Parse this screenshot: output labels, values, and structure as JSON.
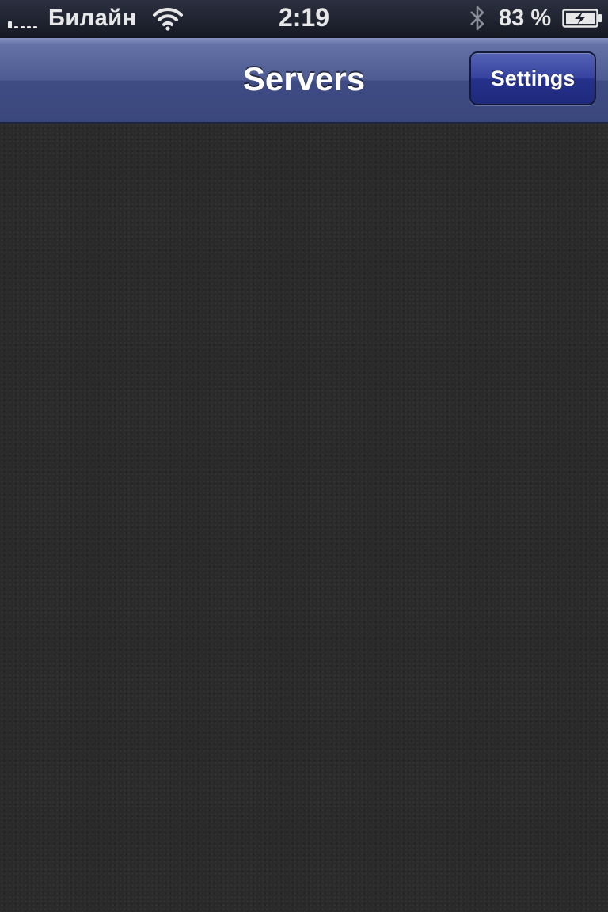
{
  "status_bar": {
    "carrier": "Билайн",
    "time": "2:19",
    "battery_percent": "83 %",
    "signal_bars_on": 1,
    "signal_bars_total": 5,
    "icons": [
      "signal-icon",
      "wifi-icon",
      "bluetooth-icon",
      "battery-charging-icon"
    ]
  },
  "nav": {
    "title": "Servers",
    "settings_label": "Settings"
  },
  "colors": {
    "nav_bar": "#4d5b92",
    "settings_button": "#2a3792",
    "background": "#2a2a2a"
  }
}
